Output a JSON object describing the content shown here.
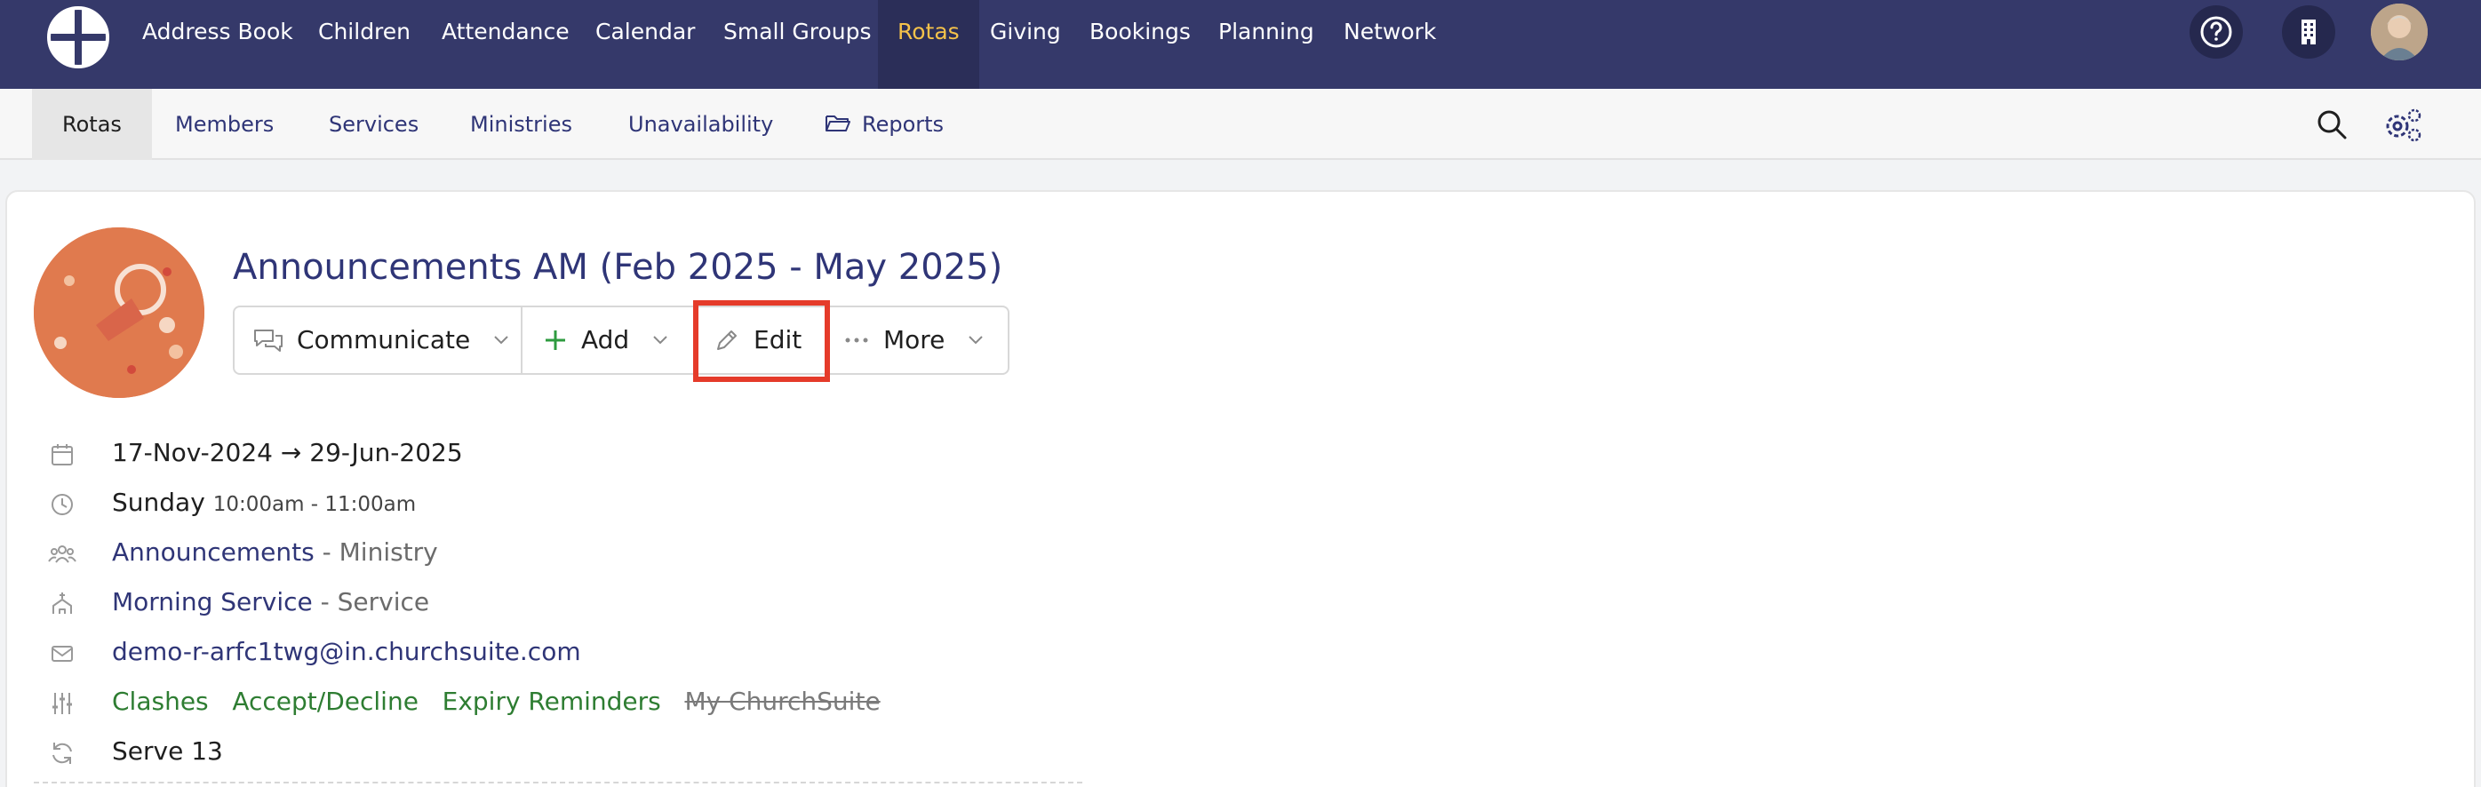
{
  "topnav": {
    "items": [
      "Address Book",
      "Children",
      "Attendance",
      "Calendar",
      "Small Groups",
      "Rotas",
      "Giving",
      "Bookings",
      "Planning",
      "Network"
    ],
    "active": "Rotas",
    "help_icon": "question-circle-icon",
    "org_icon": "building-icon"
  },
  "subnav": {
    "items": [
      "Rotas",
      "Members",
      "Services",
      "Ministries",
      "Unavailability",
      "Reports"
    ],
    "active": "Rotas"
  },
  "rota": {
    "title": "Announcements AM (Feb 2025 - May 2025)",
    "buttons": {
      "communicate": "Communicate",
      "add": "Add",
      "edit": "Edit",
      "more": "More"
    },
    "dates": "17-Nov-2024 → 29-Jun-2025",
    "day": "Sunday",
    "time": "10:00am - 11:00am",
    "ministry_name": "Announcements",
    "ministry_suffix": "- Ministry",
    "service_name": "Morning Service",
    "service_suffix": "- Service",
    "email": "demo-r-arfc1twg@in.churchsuite.com",
    "settings": [
      "Clashes",
      "Accept/Decline",
      "Expiry Reminders"
    ],
    "settings_disabled": "My ChurchSuite",
    "serve": "Serve 13"
  },
  "colors": {
    "nav_bg": "#35396a",
    "active_nav_text": "#f5c24a",
    "link": "#2f3577",
    "enabled_setting": "#2e7d32",
    "highlight": "#e53b2a"
  }
}
